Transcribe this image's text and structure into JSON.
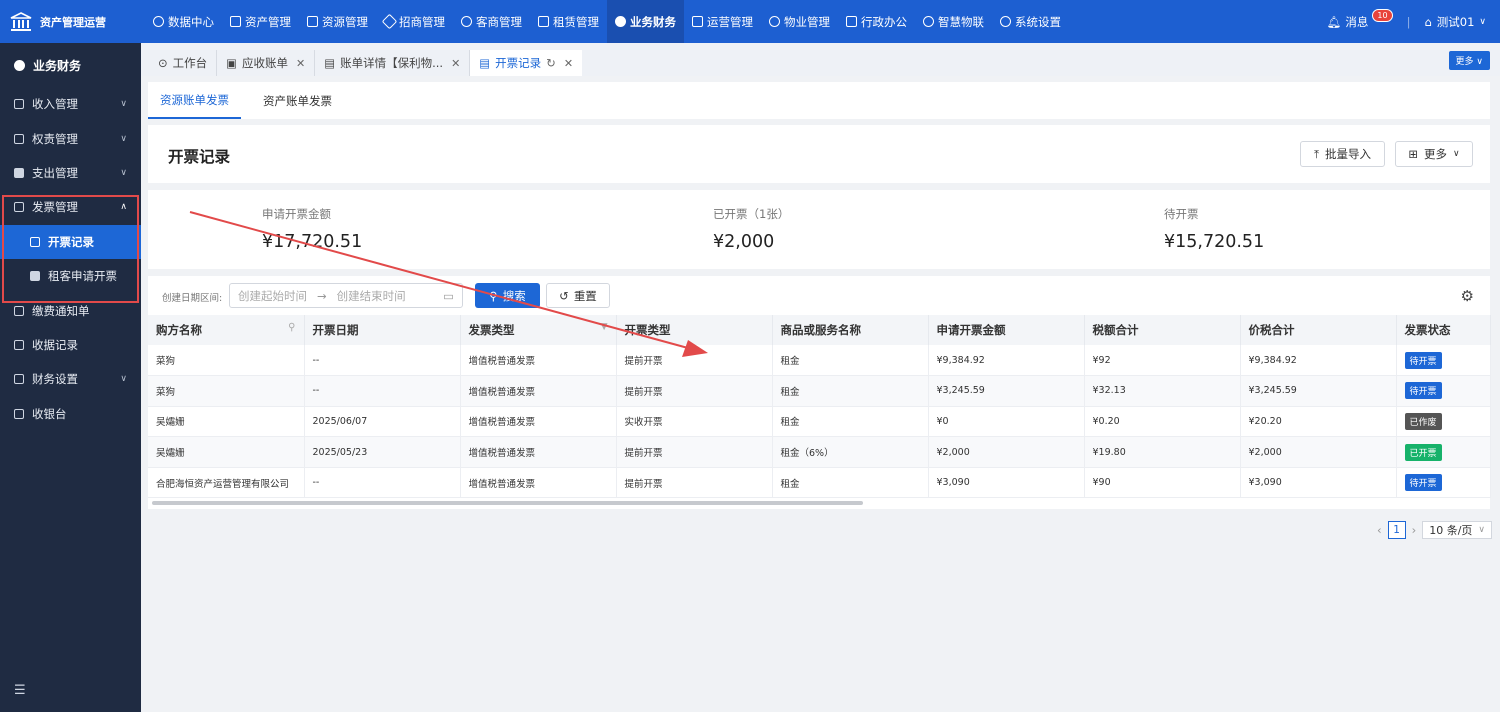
{
  "header": {
    "app_title": "资产管理运营",
    "nav": [
      {
        "label": "数据中心",
        "icon": "clock-icon"
      },
      {
        "label": "资产管理",
        "icon": "cube-icon"
      },
      {
        "label": "资源管理",
        "icon": "building-icon"
      },
      {
        "label": "招商管理",
        "icon": "tag-icon"
      },
      {
        "label": "客商管理",
        "icon": "user-icon"
      },
      {
        "label": "租赁管理",
        "icon": "home-icon"
      },
      {
        "label": "业务财务",
        "icon": "coin-icon",
        "active": true
      },
      {
        "label": "运营管理",
        "icon": "chart-icon"
      },
      {
        "label": "物业管理",
        "icon": "house-icon"
      },
      {
        "label": "行政办公",
        "icon": "monitor-icon"
      },
      {
        "label": "智慧物联",
        "icon": "sun-icon"
      },
      {
        "label": "系统设置",
        "icon": "gear-icon"
      }
    ],
    "messages_label": "消息",
    "messages_count": "10",
    "user_label": "测试01"
  },
  "sidebar": {
    "section_title": "业务财务",
    "items": [
      {
        "label": "收入管理",
        "expandable": true
      },
      {
        "label": "权责管理",
        "expandable": true
      },
      {
        "label": "支出管理",
        "expandable": true
      },
      {
        "label": "发票管理",
        "expandable": true,
        "expanded": true
      },
      {
        "label": "开票记录",
        "sub": true,
        "active": true
      },
      {
        "label": "租客申请开票",
        "sub": true
      },
      {
        "label": "缴费通知单"
      },
      {
        "label": "收据记录"
      },
      {
        "label": "财务设置",
        "expandable": true
      },
      {
        "label": "收银台"
      }
    ]
  },
  "tabs": [
    {
      "label": "工作台",
      "closable": false
    },
    {
      "label": "应收账单",
      "closable": true
    },
    {
      "label": "账单详情【保利物...",
      "closable": true
    },
    {
      "label": "开票记录",
      "closable": true,
      "active": true
    }
  ],
  "tabs_more": "更多",
  "subtabs": [
    "资源账单发票",
    "资产账单发票"
  ],
  "page": {
    "title": "开票记录",
    "import_button": "批量导入",
    "more_button": "更多"
  },
  "stats": [
    {
      "label": "申请开票金额",
      "value": "¥17,720.51"
    },
    {
      "label": "已开票（1张）",
      "value": "¥2,000"
    },
    {
      "label": "待开票",
      "value": "¥15,720.51"
    }
  ],
  "filter": {
    "label": "创建日期区间:",
    "start_placeholder": "创建起始时间",
    "end_placeholder": "创建结束时间",
    "search_button": "搜索",
    "reset_button": "重置"
  },
  "table": {
    "columns": [
      "购方名称",
      "开票日期",
      "发票类型",
      "开票类型",
      "商品或服务名称",
      "申请开票金额",
      "税额合计",
      "价税合计",
      "发票状态"
    ],
    "rows": [
      [
        "菜狗",
        "--",
        "增值税普通发票",
        "提前开票",
        "租金",
        "¥9,384.92",
        "¥92",
        "¥9,384.92",
        "待开票"
      ],
      [
        "菜狗",
        "--",
        "增值税普通发票",
        "提前开票",
        "租金",
        "¥3,245.59",
        "¥32.13",
        "¥3,245.59",
        "待开票"
      ],
      [
        "吴孀姗",
        "2025/06/07",
        "增值税普通发票",
        "实收开票",
        "租金",
        "¥0",
        "¥0.20",
        "¥20.20",
        "已作废"
      ],
      [
        "吴孀姗",
        "2025/05/23",
        "增值税普通发票",
        "提前开票",
        "租金（6%）",
        "¥2,000",
        "¥19.80",
        "¥2,000",
        "已开票"
      ],
      [
        "合肥海恒资产运营管理有限公司",
        "--",
        "增值税普通发票",
        "提前开票",
        "租金",
        "¥3,090",
        "¥90",
        "¥3,090",
        "待开票"
      ]
    ],
    "status_colors": {
      "待开票": "#1d67d6",
      "已作废": "#555555",
      "已开票": "#17b26a"
    }
  },
  "pagination": {
    "current": "1",
    "page_size": "10 条/页"
  },
  "colors": {
    "primary": "#1d67d6",
    "sidebar_bg": "#1f2b42",
    "annotation_red": "#e24a4a"
  }
}
